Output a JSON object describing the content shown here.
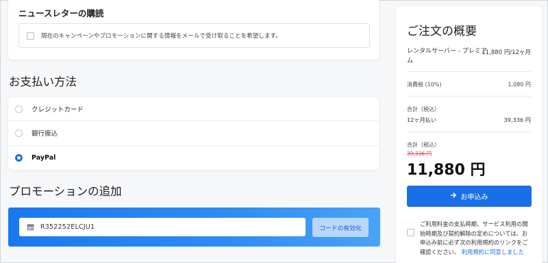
{
  "newsletter": {
    "title": "ニュースレターの購読",
    "option_text": "現在のキャンペーンやプロモーションに関する情報をメールで受け取ることを希望します。"
  },
  "payment": {
    "heading": "お支払い方法",
    "options": [
      {
        "label": "クレジットカード",
        "selected": false
      },
      {
        "label": "銀行振込",
        "selected": false
      },
      {
        "label": "PayPal",
        "selected": true
      }
    ],
    "accent_color": "#1a6fe0"
  },
  "promo": {
    "heading": "プロモーションの追加",
    "code_value": "R352252ELCJU1",
    "apply_label": "コードの有効化",
    "icon": "coupon-icon"
  },
  "summary": {
    "heading": "ご注文の概要",
    "item_name": "レンタルサーバー - プレミアム",
    "item_price": "11,880 円/12ヶ月",
    "tax_label": "消費税 (10%)",
    "tax_value": "1,080 円",
    "subtotal_label": "合計（税込）",
    "plan_label": "12ヶ月払い",
    "plan_value": "39,336 円",
    "total_label": "合計（税込）",
    "original_total": "39,336 円",
    "total": "11,880 円",
    "cta_label": "お申込み",
    "cta_icon": "arrow-right-icon",
    "terms_text": "ご利用料金の支払時期、サービス利用の開始時期及び契約解除の定めについては、お申込み前に必ず次の利用規約のリンクをご確認ください。",
    "terms_link": "利用規約に同意しました"
  }
}
